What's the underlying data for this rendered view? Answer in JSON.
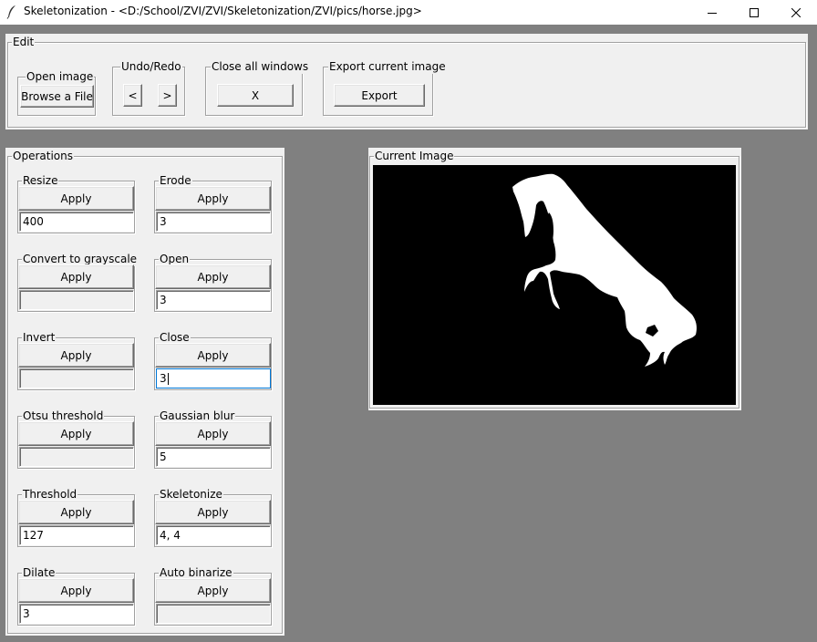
{
  "window": {
    "title": "Skeletonization - <D:/School/ZVI/ZVI/Skeletonization/ZVI/pics/horse.jpg>",
    "app_icon": "feather-icon",
    "controls": [
      "minimize-icon",
      "maximize-icon",
      "close-icon"
    ]
  },
  "edit": {
    "label": "Edit",
    "open_image": {
      "label": "Open image",
      "button": "Browse a File"
    },
    "undo_redo": {
      "label": "Undo/Redo",
      "undo": "<",
      "redo": ">"
    },
    "close_all": {
      "label": "Close all windows",
      "button": "X"
    },
    "export": {
      "label": "Export current image",
      "button": "Export"
    }
  },
  "operations": {
    "label": "Operations",
    "left": [
      {
        "label": "Resize",
        "button": "Apply",
        "value": "400",
        "enabled": true
      },
      {
        "label": "Convert to grayscale",
        "button": "Apply",
        "value": "",
        "enabled": false
      },
      {
        "label": "Invert",
        "button": "Apply",
        "value": "",
        "enabled": false
      },
      {
        "label": "Otsu threshold",
        "button": "Apply",
        "value": "",
        "enabled": false
      },
      {
        "label": "Threshold",
        "button": "Apply",
        "value": "127",
        "enabled": true
      },
      {
        "label": "Dilate",
        "button": "Apply",
        "value": "3",
        "enabled": true
      }
    ],
    "right": [
      {
        "label": "Erode",
        "button": "Apply",
        "value": "3",
        "enabled": true
      },
      {
        "label": "Open",
        "button": "Apply",
        "value": "3",
        "enabled": true
      },
      {
        "label": "Close",
        "button": "Apply",
        "value": "3",
        "enabled": true,
        "focused": true
      },
      {
        "label": "Gaussian blur",
        "button": "Apply",
        "value": "5",
        "enabled": true
      },
      {
        "label": "Skeletonize",
        "button": "Apply",
        "value": "4, 4",
        "enabled": true
      },
      {
        "label": "Auto binarize",
        "button": "Apply",
        "value": "",
        "enabled": false
      }
    ]
  },
  "current_image": {
    "label": "Current Image",
    "content": "binary horse silhouette, white on black"
  }
}
